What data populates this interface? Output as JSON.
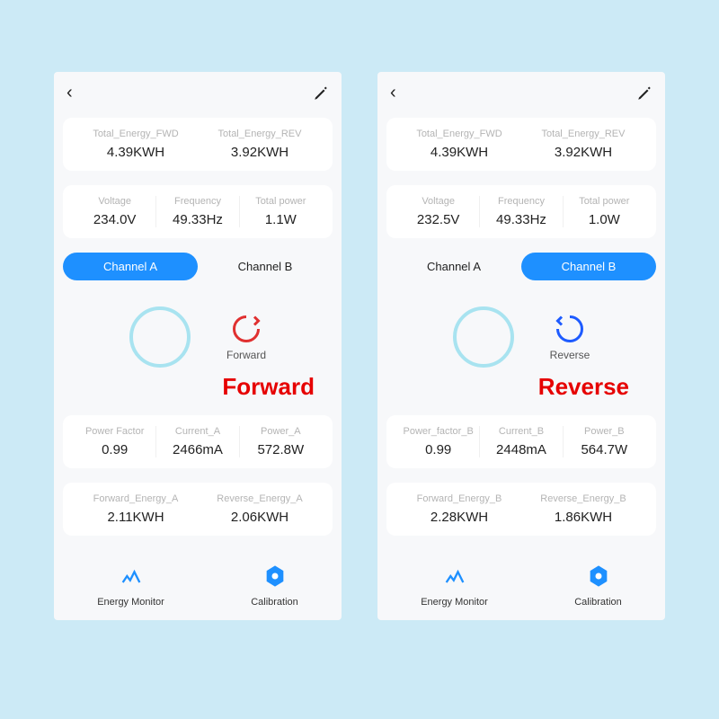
{
  "left": {
    "tot_fwd": {
      "lbl": "Total_Energy_FWD",
      "val": "4.39KWH"
    },
    "tot_rev": {
      "lbl": "Total_Energy_REV",
      "val": "3.92KWH"
    },
    "voltage": {
      "lbl": "Voltage",
      "val": "234.0V"
    },
    "freq": {
      "lbl": "Frequency",
      "val": "49.33Hz"
    },
    "power": {
      "lbl": "Total power",
      "val": "1.1W"
    },
    "tab_a": "Channel A",
    "tab_b": "Channel B",
    "active": "A",
    "dir_label": "Forward",
    "dir_overlay": "Forward",
    "pf": {
      "lbl": "Power Factor",
      "val": "0.99"
    },
    "cur": {
      "lbl": "Current_A",
      "val": "2466mA"
    },
    "pw": {
      "lbl": "Power_A",
      "val": "572.8W"
    },
    "fe": {
      "lbl": "Forward_Energy_A",
      "val": "2.11KWH"
    },
    "re": {
      "lbl": "Reverse_Energy_A",
      "val": "2.06KWH"
    },
    "nav1": "Energy Monitor",
    "nav2": "Calibration"
  },
  "right": {
    "tot_fwd": {
      "lbl": "Total_Energy_FWD",
      "val": "4.39KWH"
    },
    "tot_rev": {
      "lbl": "Total_Energy_REV",
      "val": "3.92KWH"
    },
    "voltage": {
      "lbl": "Voltage",
      "val": "232.5V"
    },
    "freq": {
      "lbl": "Frequency",
      "val": "49.33Hz"
    },
    "power": {
      "lbl": "Total power",
      "val": "1.0W"
    },
    "tab_a": "Channel A",
    "tab_b": "Channel B",
    "active": "B",
    "dir_label": "Reverse",
    "dir_overlay": "Reverse",
    "pf": {
      "lbl": "Power_factor_B",
      "val": "0.99"
    },
    "cur": {
      "lbl": "Current_B",
      "val": "2448mA"
    },
    "pw": {
      "lbl": "Power_B",
      "val": "564.7W"
    },
    "fe": {
      "lbl": "Forward_Energy_B",
      "val": "2.28KWH"
    },
    "re": {
      "lbl": "Reverse_Energy_B",
      "val": "1.86KWH"
    },
    "nav1": "Energy Monitor",
    "nav2": "Calibration"
  }
}
